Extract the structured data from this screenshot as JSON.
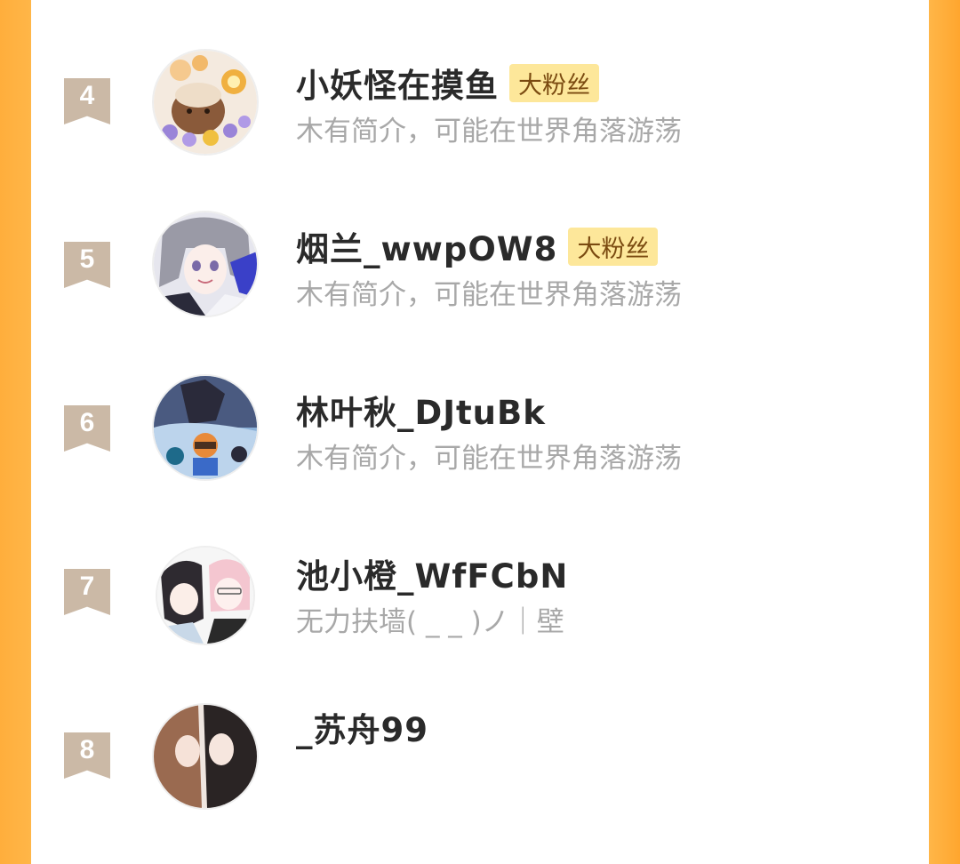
{
  "entries": [
    {
      "rank": "4",
      "name": "小妖怪在摸鱼",
      "badge": "大粉丝",
      "bio": "木有简介，可能在世界角落游荡",
      "avatar_icon": "chibi-cat-avatar-icon"
    },
    {
      "rank": "5",
      "name": "烟兰_wwpOW8",
      "badge": "大粉丝",
      "bio": "木有简介，可能在世界角落游荡",
      "avatar_icon": "anime-girl-avatar-icon"
    },
    {
      "rank": "6",
      "name": "林叶秋_DJtuBk",
      "badge": "",
      "bio": "木有简介，可能在世界角落游荡",
      "avatar_icon": "fantasy-scene-avatar-icon"
    },
    {
      "rank": "7",
      "name": "池小橙_WfFCbN",
      "badge": "",
      "bio": "无力扶墙(   _    _ )ノ｜壁",
      "avatar_icon": "anime-duo-avatar-icon"
    },
    {
      "rank": "8",
      "name": "_苏舟99",
      "badge": "",
      "bio": "",
      "avatar_icon": "couple-avatar-icon"
    }
  ],
  "colors": {
    "rank_badge": "#cbb9a6",
    "fan_badge_bg": "#fde79a",
    "side_orange": "#ffb648"
  }
}
